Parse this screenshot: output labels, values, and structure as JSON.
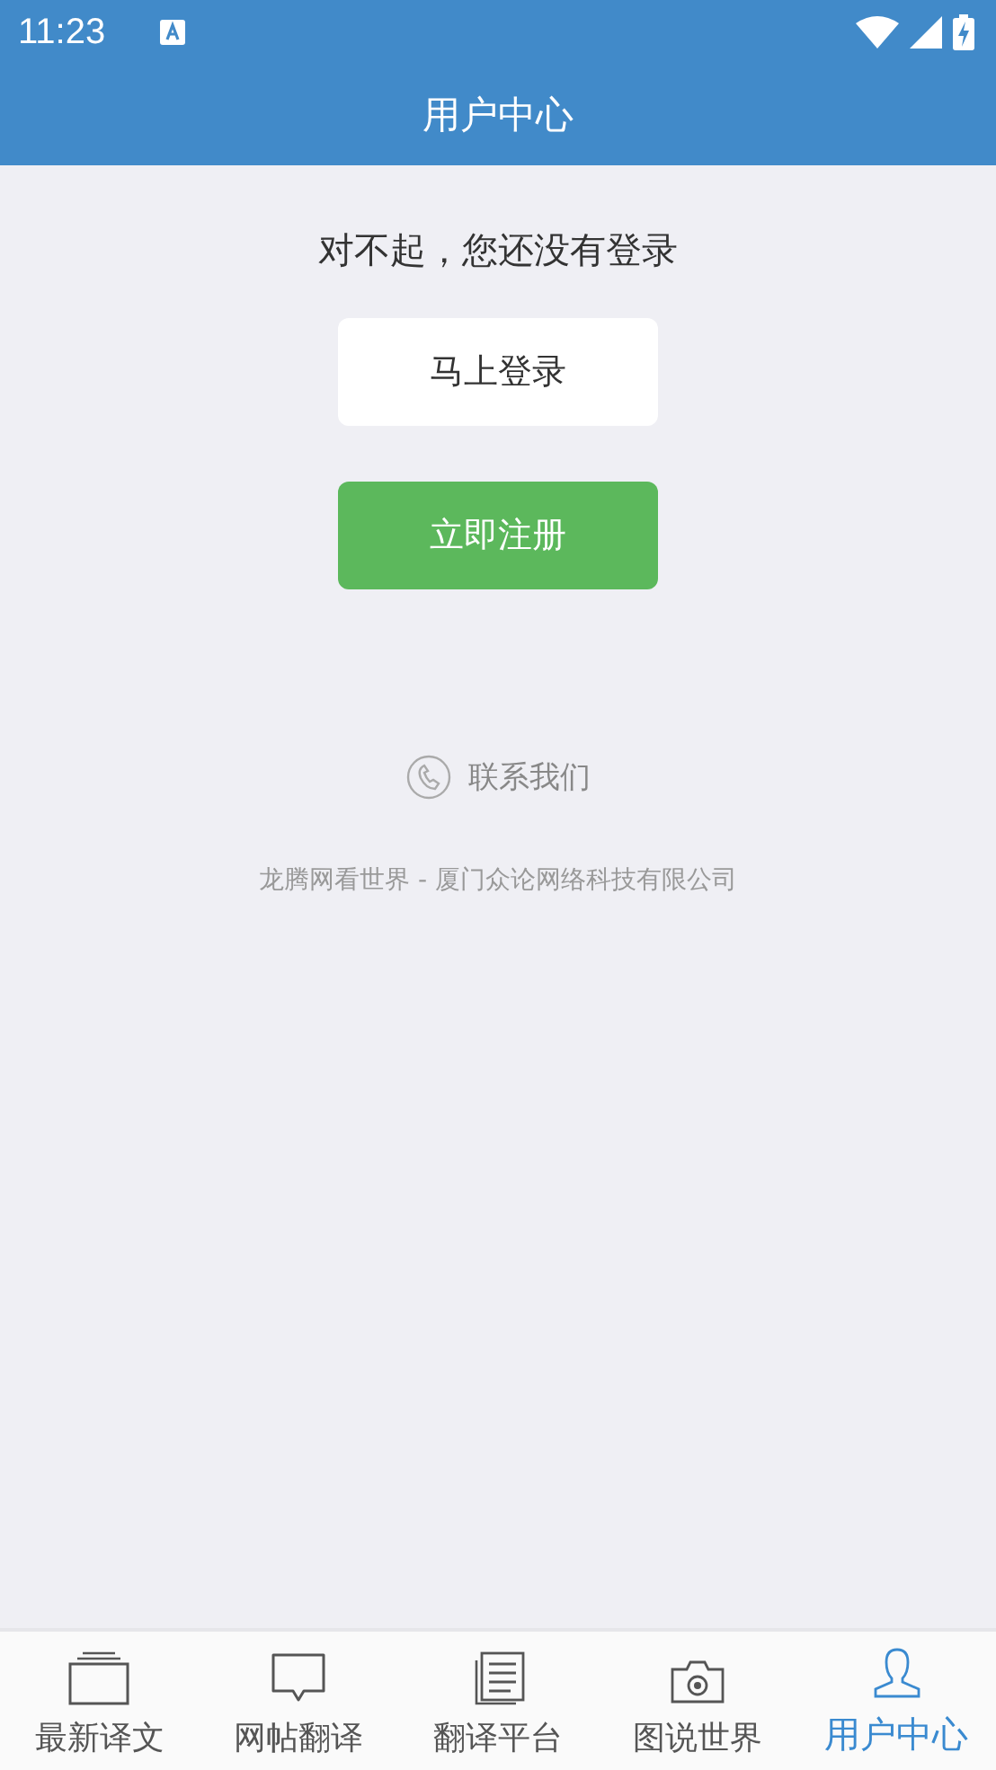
{
  "status_bar": {
    "time": "11:23"
  },
  "header": {
    "title": "用户中心"
  },
  "message": "对不起，您还没有登录",
  "buttons": [
    {
      "label": "马上登录",
      "kind": "login"
    },
    {
      "label": "立即注册",
      "kind": "register"
    }
  ],
  "contact": {
    "label": "联系我们"
  },
  "footer": "龙腾网看世界 - 厦门众论网络科技有限公司",
  "tabs": [
    {
      "label": "最新译文",
      "selected": false
    },
    {
      "label": "网帖翻译",
      "selected": false
    },
    {
      "label": "翻译平台",
      "selected": false
    },
    {
      "label": "图说世界",
      "selected": false
    },
    {
      "label": "用户中心",
      "selected": true
    }
  ]
}
